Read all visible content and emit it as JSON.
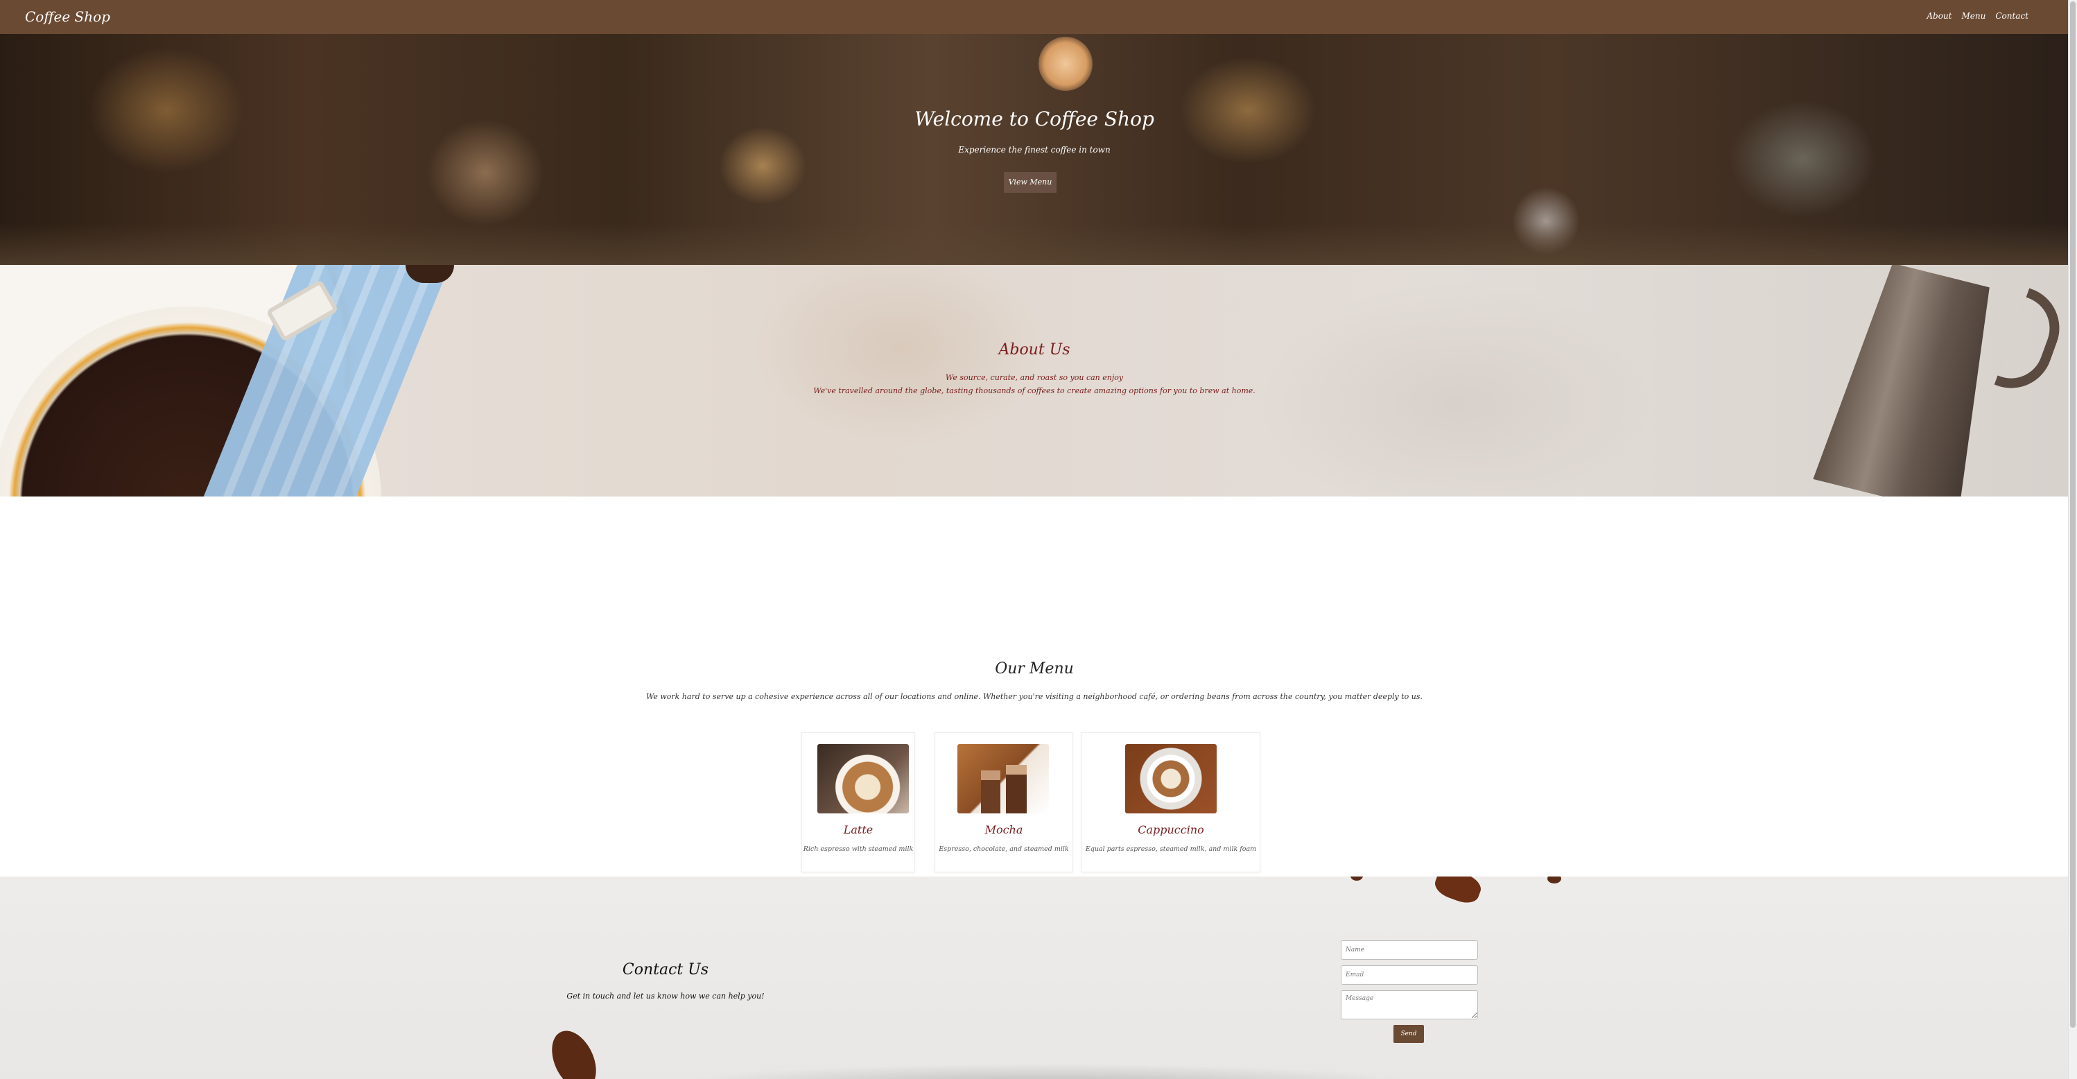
{
  "nav": {
    "brand": "Coffee Shop",
    "links": [
      "About",
      "Menu",
      "Contact"
    ]
  },
  "hero": {
    "title": "Welcome to Coffee Shop",
    "subtitle": "Experience the finest coffee in town",
    "button": "View Menu"
  },
  "about": {
    "title": "About Us",
    "line1": "We source, curate, and roast so you can enjoy",
    "line2": "We've travelled around the globe, tasting thousands of coffees to create amazing options for you to brew at home."
  },
  "menu": {
    "title": "Our Menu",
    "description": "We work hard to serve up a cohesive experience across all of our locations and online. Whether you're visiting a neighborhood café, or ordering beans from across the country, you matter deeply to us.",
    "items": [
      {
        "name": "Latte",
        "description": "Rich espresso with steamed milk"
      },
      {
        "name": "Mocha",
        "description": "Espresso, chocolate, and steamed milk"
      },
      {
        "name": "Cappuccino",
        "description": "Equal parts espresso, steamed milk, and milk foam"
      }
    ]
  },
  "contact": {
    "title": "Contact Us",
    "subtitle": "Get in touch and let us know how we can help you!",
    "name_placeholder": "Name",
    "email_placeholder": "Email",
    "message_placeholder": "Message",
    "send": "Send"
  },
  "colors": {
    "nav": "#6b4a33",
    "accent_text": "#7a1d1d",
    "button": "#6b4a33"
  }
}
